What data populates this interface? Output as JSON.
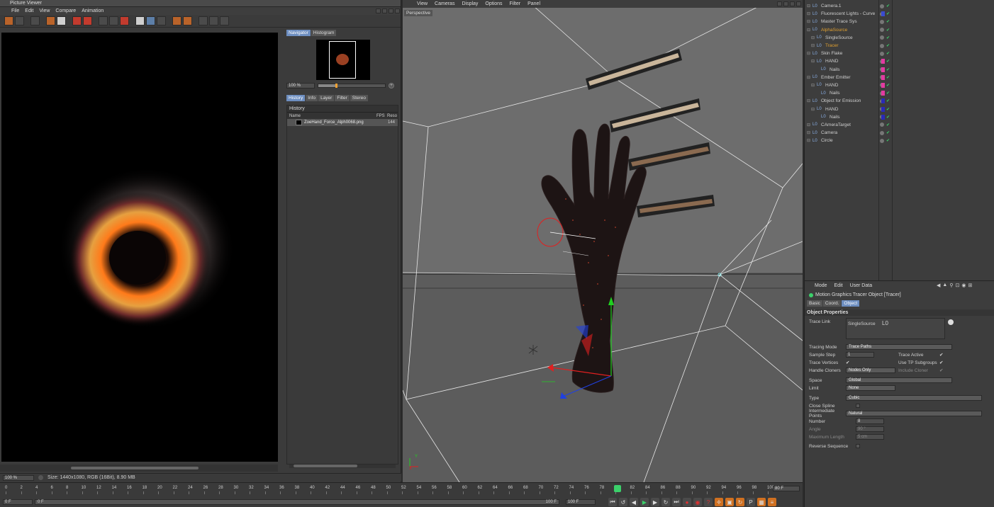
{
  "picture_viewer": {
    "title": "Picture Viewer",
    "menu": [
      "File",
      "Edit",
      "View",
      "Compare",
      "Animation"
    ],
    "nav_tabs": [
      "Navigator",
      "Histogram"
    ],
    "zoom": "100 %",
    "history_tabs": [
      "History",
      "Info",
      "Layer",
      "Filter",
      "Stereo"
    ],
    "history_title": "History",
    "history_columns": [
      "Name",
      "FPS",
      "Reso"
    ],
    "history_item": {
      "name": "ZoeHand_Force_Alph0068.png",
      "res": "144"
    },
    "status_zoom": "100 %",
    "status_size": "Size: 1440x1080, RGB (16Bit), 8.90 MB"
  },
  "viewport": {
    "menu": [
      "View",
      "Cameras",
      "Display",
      "Options",
      "Filter",
      "Panel"
    ],
    "label": "Perspective",
    "axis_y": "Y",
    "axis_x": "X"
  },
  "object_manager": {
    "objects": [
      {
        "name": "Camera.1",
        "indent": 0,
        "color": "#cfcfcf",
        "tag": ""
      },
      {
        "name": "Fluorescent Lights - Curve",
        "indent": 0,
        "color": "#cfcfcf",
        "tag": "#3a4bd0"
      },
      {
        "name": "Master Trace Sys",
        "indent": 0,
        "color": "#cfcfcf",
        "tag": ""
      },
      {
        "name": "AlphaSource",
        "indent": 0,
        "color": "#e0a030",
        "tag": ""
      },
      {
        "name": "SingleSource",
        "indent": 1,
        "color": "#cfcfcf",
        "tag": ""
      },
      {
        "name": "Tracer",
        "indent": 1,
        "color": "#e0a030",
        "tag": ""
      },
      {
        "name": "Skin Flake",
        "indent": 0,
        "color": "#cfcfcf",
        "tag": ""
      },
      {
        "name": "HAND",
        "indent": 1,
        "color": "#cfcfcf",
        "tag": "#e23aa0"
      },
      {
        "name": "Nails",
        "indent": 2,
        "color": "#cfcfcf",
        "tag": "#e23aa0"
      },
      {
        "name": "Ember Emitter",
        "indent": 0,
        "color": "#cfcfcf",
        "tag": "#e23aa0"
      },
      {
        "name": "HAND",
        "indent": 1,
        "color": "#cfcfcf",
        "tag": "#e23aa0"
      },
      {
        "name": "Nails",
        "indent": 2,
        "color": "#cfcfcf",
        "tag": "#e23aa0"
      },
      {
        "name": "Object for Emission",
        "indent": 0,
        "color": "#cfcfcf",
        "tag": "#2a2ab8"
      },
      {
        "name": "HAND",
        "indent": 1,
        "color": "#cfcfcf",
        "tag": "#2a2ab8"
      },
      {
        "name": "Nails",
        "indent": 2,
        "color": "#cfcfcf",
        "tag": "#2a2ab8"
      },
      {
        "name": "CAmeraTarget",
        "indent": 0,
        "color": "#cfcfcf",
        "tag": ""
      },
      {
        "name": "Camera",
        "indent": 0,
        "color": "#cfcfcf",
        "tag": ""
      },
      {
        "name": "Circle",
        "indent": 0,
        "color": "#cfcfcf",
        "tag": ""
      }
    ]
  },
  "attributes": {
    "menu": [
      "Mode",
      "Edit",
      "User Data"
    ],
    "object_title": "Motion Graphics Tracer Object [Tracer]",
    "tabs": [
      "Basic",
      "Coord.",
      "Object"
    ],
    "section": "Object Properties",
    "trace_link_label": "Trace Link",
    "trace_link_value": "SingleSource",
    "tracing_mode_label": "Tracing Mode",
    "tracing_mode_value": "Trace Paths",
    "sample_step_label": "Sample Step",
    "sample_step_value": "1",
    "trace_active_label": "Trace Active",
    "trace_vertices_label": "Trace Vertices",
    "use_tp_label": "Use TP Subgroups",
    "handle_cloners_label": "Handle Cloners",
    "handle_cloners_value": "Nodes Only",
    "include_cloner_label": "Include Cloner",
    "space_label": "Space",
    "space_value": "Global",
    "limit_label": "Limit",
    "limit_value": "None",
    "type_label": "Type",
    "type_value": "Cubic",
    "close_spline_label": "Close Spline",
    "intermediate_label": "Intermediate Points",
    "intermediate_value": "Natural",
    "number_label": "Number",
    "number_value": "8",
    "angle_label": "Angle",
    "angle_value": "90 °",
    "max_length_label": "Maximum Length",
    "max_length_value": "5 cm",
    "reverse_label": "Reverse Sequence"
  },
  "timeline": {
    "ticks": [
      "0",
      "2",
      "4",
      "6",
      "8",
      "10",
      "12",
      "14",
      "16",
      "18",
      "20",
      "22",
      "24",
      "26",
      "28",
      "30",
      "32",
      "34",
      "36",
      "38",
      "40",
      "42",
      "44",
      "46",
      "48",
      "50",
      "52",
      "54",
      "56",
      "58",
      "60",
      "62",
      "64",
      "66",
      "68",
      "70",
      "72",
      "74",
      "76",
      "78",
      "80",
      "82",
      "84",
      "86",
      "88",
      "90",
      "92",
      "94",
      "96",
      "98",
      "100"
    ],
    "current": "80 F",
    "start": "0 F",
    "start_field": "0 F",
    "end_a": "100 F",
    "end_b": "100 F"
  }
}
